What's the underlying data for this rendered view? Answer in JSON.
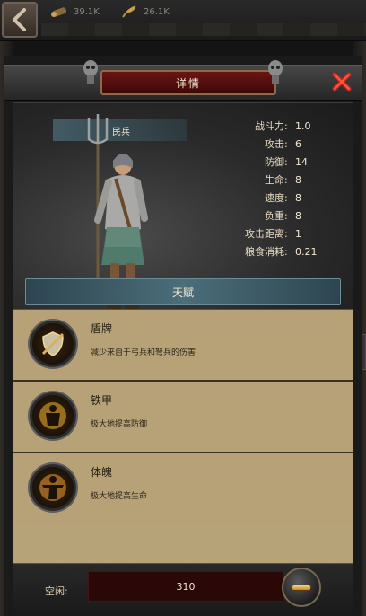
{
  "topbar": {
    "back_icon": "chevron-left-icon",
    "resources": [
      {
        "icon": "wood-icon",
        "value": "39.1K"
      },
      {
        "icon": "food-icon",
        "value": "26.1K"
      }
    ]
  },
  "dialog": {
    "title": "详情",
    "close_icon": "close-icon"
  },
  "unit": {
    "name": "民兵",
    "page_count": 9,
    "active_page": 0,
    "stats": [
      {
        "label": "战斗力",
        "value": "1.0"
      },
      {
        "label": "攻击",
        "value": "6"
      },
      {
        "label": "防御",
        "value": "14"
      },
      {
        "label": "生命",
        "value": "8"
      },
      {
        "label": "速度",
        "value": "8"
      },
      {
        "label": "负重",
        "value": "8"
      },
      {
        "label": "攻击距离",
        "value": "1"
      },
      {
        "label": "粮食消耗",
        "value": "0.21"
      }
    ]
  },
  "talents": {
    "header": "天赋",
    "items": [
      {
        "name": "盾牌",
        "description": "减少来自于弓兵和弩兵的伤害",
        "icon": "shield-sword-icon"
      },
      {
        "name": "铁甲",
        "description": "极大地提高防御",
        "icon": "armor-icon"
      },
      {
        "name": "体魄",
        "description": "极大地提高生命",
        "icon": "strength-icon"
      }
    ]
  },
  "bottom": {
    "idle_label": "空闲:",
    "idle_value": "310",
    "minus_icon": "minus-icon"
  },
  "colors": {
    "title_red": "#6a1414",
    "parchment": "#b6a276",
    "talent_header": "#4b6e7a",
    "close_red": "#c8281e"
  }
}
